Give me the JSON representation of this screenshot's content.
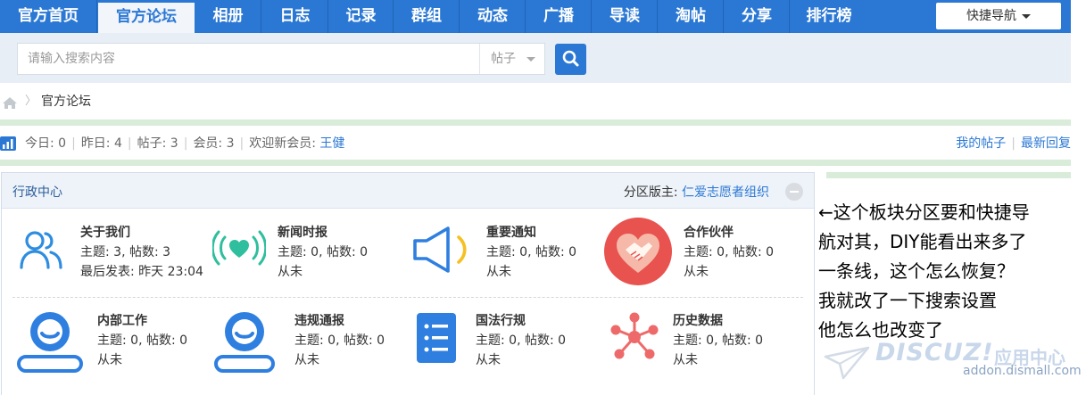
{
  "nav": {
    "items": [
      "官方首页",
      "官方论坛",
      "相册",
      "日志",
      "记录",
      "群组",
      "动态",
      "广播",
      "导读",
      "淘帖",
      "分享",
      "排行榜"
    ],
    "active_index": 1,
    "quick_nav_label": "快捷导航"
  },
  "search": {
    "placeholder": "请输入搜索内容",
    "type_label": "帖子"
  },
  "breadcrumb": {
    "separator": "〉",
    "current": "官方论坛"
  },
  "stats": {
    "today_label": "今日:",
    "today_value": "0",
    "yesterday_label": "昨日:",
    "yesterday_value": "4",
    "posts_label": "帖子:",
    "posts_value": "3",
    "members_label": "会员:",
    "members_value": "3",
    "welcome_label": "欢迎新会员:",
    "welcome_user": "王健",
    "my_posts": "我的帖子",
    "latest_reply": "最新回复"
  },
  "category": {
    "title": "行政中心",
    "moderator_label": "分区版主:",
    "moderator": "仁爱志愿者组织",
    "forums": [
      {
        "name": "关于我们",
        "stat": "主题: 3, 帖数: 3",
        "last": "最后发表: 昨天 23:04",
        "icon": "users-icon"
      },
      {
        "name": "新闻时报",
        "stat": "主题: 0, 帖数: 0",
        "last": "从未",
        "icon": "broadcast-heart-icon"
      },
      {
        "name": "重要通知",
        "stat": "主题: 0, 帖数: 0",
        "last": "从未",
        "icon": "speaker-icon"
      },
      {
        "name": "合作伙伴",
        "stat": "主题: 0, 帖数: 0",
        "last": "从未",
        "icon": "handshake-heart-icon"
      },
      {
        "name": "内部工作",
        "stat": "主题: 0, 帖数: 0",
        "last": "从未",
        "icon": "webcam-icon"
      },
      {
        "name": "违规通报",
        "stat": "主题: 0, 帖数: 0",
        "last": "从未",
        "icon": "webcam-icon"
      },
      {
        "name": "国法行规",
        "stat": "主题: 0, 帖数: 0",
        "last": "从未",
        "icon": "list-document-icon"
      },
      {
        "name": "历史数据",
        "stat": "主题: 0, 帖数: 0",
        "last": "从未",
        "icon": "network-nodes-icon"
      }
    ]
  },
  "note": {
    "lines": [
      "←这个板块分区要和快捷导",
      "航对其，DIY能看出来多了",
      "一条线，这个怎么恢复？",
      "我就改了一下搜索设置",
      "他怎么也改变了"
    ]
  },
  "watermark": {
    "logo": "DISCUZ!",
    "cn": "应用中心",
    "url": "addon.dismall.com"
  },
  "colors": {
    "nav_blue": "#2b78d4",
    "link_blue": "#2b78d4",
    "green_line": "#d9ebd9",
    "heart_red": "#e8524f"
  }
}
